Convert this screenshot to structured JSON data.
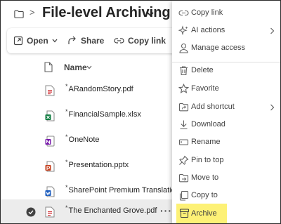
{
  "header": {
    "title": "File-level Archiving",
    "separator": ">"
  },
  "command_bar": {
    "open_label": "Open",
    "share_label": "Share",
    "copy_link_label": "Copy link"
  },
  "list": {
    "column_name": "Name",
    "files": [
      {
        "new_mark": "*",
        "name": "ARandomStory.pdf",
        "type": "pdf"
      },
      {
        "new_mark": "*",
        "name": "FinancialSample.xlsx",
        "type": "xlsx"
      },
      {
        "new_mark": "*",
        "name": "OneNote",
        "type": "onenote"
      },
      {
        "new_mark": "*",
        "name": "Presentation.pptx",
        "type": "pptx"
      },
      {
        "new_mark": "*",
        "name": "SharePoint Premium Translation.d",
        "type": "docx"
      },
      {
        "new_mark": "*",
        "name": "The Enchanted Grove.pdf",
        "type": "pdf",
        "selected": true,
        "more": "···"
      }
    ]
  },
  "menu": {
    "items": [
      {
        "label": "Copy link",
        "icon": "link-icon"
      },
      {
        "label": "AI actions",
        "icon": "ai-sparkle-icon",
        "submenu": true
      },
      {
        "label": "Manage access",
        "icon": "person-icon"
      },
      {
        "label": "Delete",
        "icon": "trash-icon"
      },
      {
        "label": "Favorite",
        "icon": "star-icon"
      },
      {
        "label": "Add shortcut",
        "icon": "shortcut-icon",
        "submenu": true
      },
      {
        "label": "Download",
        "icon": "download-icon"
      },
      {
        "label": "Rename",
        "icon": "rename-icon"
      },
      {
        "label": "Pin to top",
        "icon": "pin-icon"
      },
      {
        "label": "Move to",
        "icon": "move-icon"
      },
      {
        "label": "Copy to",
        "icon": "copy-icon"
      },
      {
        "label": "Archive",
        "icon": "archive-icon",
        "highlighted": true
      }
    ]
  },
  "colors": {
    "pdf": "#d13438",
    "xlsx": "#107c41",
    "onenote": "#7719aa",
    "pptx": "#c43e1c",
    "docx": "#185abd",
    "highlight": "#fdf176"
  }
}
